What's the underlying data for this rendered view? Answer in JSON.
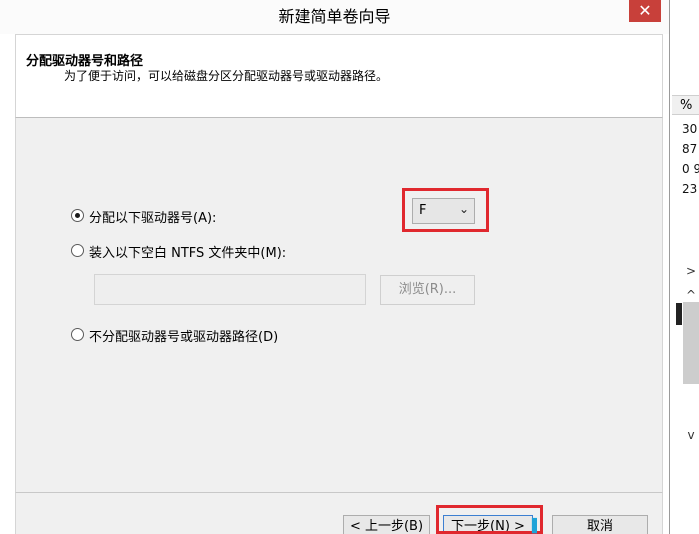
{
  "window": {
    "title": "新建简单卷向导",
    "close_glyph": "✕"
  },
  "header": {
    "title": "分配驱动器号和路径",
    "description": "为了便于访问，可以给磁盘分区分配驱动器号或驱动器路径。"
  },
  "options": {
    "assign_letter": {
      "label": "分配以下驱动器号(A):",
      "checked": true
    },
    "mount_folder": {
      "label": "装入以下空白 NTFS 文件夹中(M):",
      "checked": false
    },
    "no_assign": {
      "label": "不分配驱动器号或驱动器路径(D)",
      "checked": false
    }
  },
  "drive_letter": {
    "value": "F",
    "chevron": "⌄"
  },
  "folder_path": {
    "value": ""
  },
  "browse_button": {
    "label": "浏览(R)..."
  },
  "nav": {
    "back": "< 上一步(B)",
    "next": "下一步(N) >",
    "cancel": "取消"
  },
  "background_window": {
    "column_header": "%",
    "cells": [
      "30",
      "87",
      "0 9",
      "23"
    ],
    "scroll_right": ">",
    "scroll_up": "^",
    "scroll_down": "v"
  },
  "colors": {
    "highlight": "#e0282e",
    "close_button": "#c8403a",
    "panel_bg": "#f0f0f0",
    "accent_border": "#3c7fd1"
  }
}
